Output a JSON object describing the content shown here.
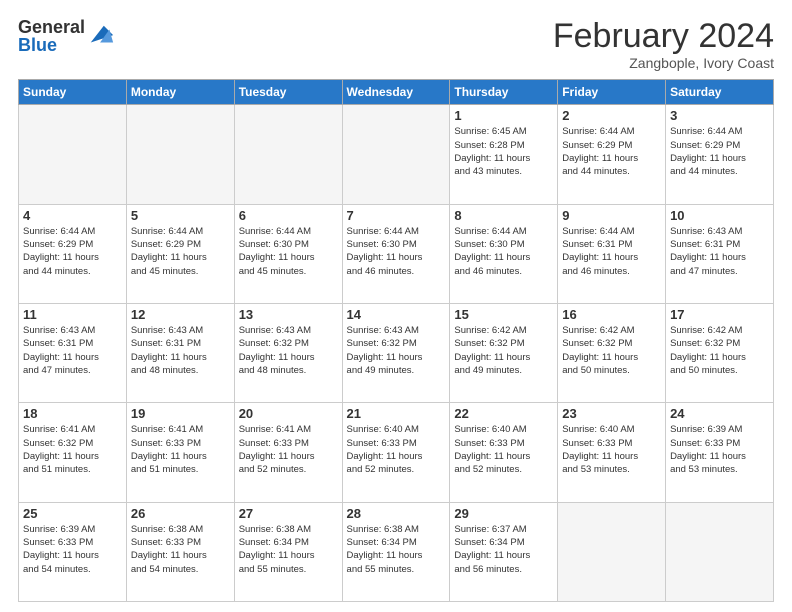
{
  "logo": {
    "general": "General",
    "blue": "Blue"
  },
  "header": {
    "month": "February 2024",
    "location": "Zangbople, Ivory Coast"
  },
  "weekdays": [
    "Sunday",
    "Monday",
    "Tuesday",
    "Wednesday",
    "Thursday",
    "Friday",
    "Saturday"
  ],
  "weeks": [
    [
      {
        "day": "",
        "info": ""
      },
      {
        "day": "",
        "info": ""
      },
      {
        "day": "",
        "info": ""
      },
      {
        "day": "",
        "info": ""
      },
      {
        "day": "1",
        "info": "Sunrise: 6:45 AM\nSunset: 6:28 PM\nDaylight: 11 hours\nand 43 minutes."
      },
      {
        "day": "2",
        "info": "Sunrise: 6:44 AM\nSunset: 6:29 PM\nDaylight: 11 hours\nand 44 minutes."
      },
      {
        "day": "3",
        "info": "Sunrise: 6:44 AM\nSunset: 6:29 PM\nDaylight: 11 hours\nand 44 minutes."
      }
    ],
    [
      {
        "day": "4",
        "info": "Sunrise: 6:44 AM\nSunset: 6:29 PM\nDaylight: 11 hours\nand 44 minutes."
      },
      {
        "day": "5",
        "info": "Sunrise: 6:44 AM\nSunset: 6:29 PM\nDaylight: 11 hours\nand 45 minutes."
      },
      {
        "day": "6",
        "info": "Sunrise: 6:44 AM\nSunset: 6:30 PM\nDaylight: 11 hours\nand 45 minutes."
      },
      {
        "day": "7",
        "info": "Sunrise: 6:44 AM\nSunset: 6:30 PM\nDaylight: 11 hours\nand 46 minutes."
      },
      {
        "day": "8",
        "info": "Sunrise: 6:44 AM\nSunset: 6:30 PM\nDaylight: 11 hours\nand 46 minutes."
      },
      {
        "day": "9",
        "info": "Sunrise: 6:44 AM\nSunset: 6:31 PM\nDaylight: 11 hours\nand 46 minutes."
      },
      {
        "day": "10",
        "info": "Sunrise: 6:43 AM\nSunset: 6:31 PM\nDaylight: 11 hours\nand 47 minutes."
      }
    ],
    [
      {
        "day": "11",
        "info": "Sunrise: 6:43 AM\nSunset: 6:31 PM\nDaylight: 11 hours\nand 47 minutes."
      },
      {
        "day": "12",
        "info": "Sunrise: 6:43 AM\nSunset: 6:31 PM\nDaylight: 11 hours\nand 48 minutes."
      },
      {
        "day": "13",
        "info": "Sunrise: 6:43 AM\nSunset: 6:32 PM\nDaylight: 11 hours\nand 48 minutes."
      },
      {
        "day": "14",
        "info": "Sunrise: 6:43 AM\nSunset: 6:32 PM\nDaylight: 11 hours\nand 49 minutes."
      },
      {
        "day": "15",
        "info": "Sunrise: 6:42 AM\nSunset: 6:32 PM\nDaylight: 11 hours\nand 49 minutes."
      },
      {
        "day": "16",
        "info": "Sunrise: 6:42 AM\nSunset: 6:32 PM\nDaylight: 11 hours\nand 50 minutes."
      },
      {
        "day": "17",
        "info": "Sunrise: 6:42 AM\nSunset: 6:32 PM\nDaylight: 11 hours\nand 50 minutes."
      }
    ],
    [
      {
        "day": "18",
        "info": "Sunrise: 6:41 AM\nSunset: 6:32 PM\nDaylight: 11 hours\nand 51 minutes."
      },
      {
        "day": "19",
        "info": "Sunrise: 6:41 AM\nSunset: 6:33 PM\nDaylight: 11 hours\nand 51 minutes."
      },
      {
        "day": "20",
        "info": "Sunrise: 6:41 AM\nSunset: 6:33 PM\nDaylight: 11 hours\nand 52 minutes."
      },
      {
        "day": "21",
        "info": "Sunrise: 6:40 AM\nSunset: 6:33 PM\nDaylight: 11 hours\nand 52 minutes."
      },
      {
        "day": "22",
        "info": "Sunrise: 6:40 AM\nSunset: 6:33 PM\nDaylight: 11 hours\nand 52 minutes."
      },
      {
        "day": "23",
        "info": "Sunrise: 6:40 AM\nSunset: 6:33 PM\nDaylight: 11 hours\nand 53 minutes."
      },
      {
        "day": "24",
        "info": "Sunrise: 6:39 AM\nSunset: 6:33 PM\nDaylight: 11 hours\nand 53 minutes."
      }
    ],
    [
      {
        "day": "25",
        "info": "Sunrise: 6:39 AM\nSunset: 6:33 PM\nDaylight: 11 hours\nand 54 minutes."
      },
      {
        "day": "26",
        "info": "Sunrise: 6:38 AM\nSunset: 6:33 PM\nDaylight: 11 hours\nand 54 minutes."
      },
      {
        "day": "27",
        "info": "Sunrise: 6:38 AM\nSunset: 6:34 PM\nDaylight: 11 hours\nand 55 minutes."
      },
      {
        "day": "28",
        "info": "Sunrise: 6:38 AM\nSunset: 6:34 PM\nDaylight: 11 hours\nand 55 minutes."
      },
      {
        "day": "29",
        "info": "Sunrise: 6:37 AM\nSunset: 6:34 PM\nDaylight: 11 hours\nand 56 minutes."
      },
      {
        "day": "",
        "info": ""
      },
      {
        "day": "",
        "info": ""
      }
    ]
  ]
}
